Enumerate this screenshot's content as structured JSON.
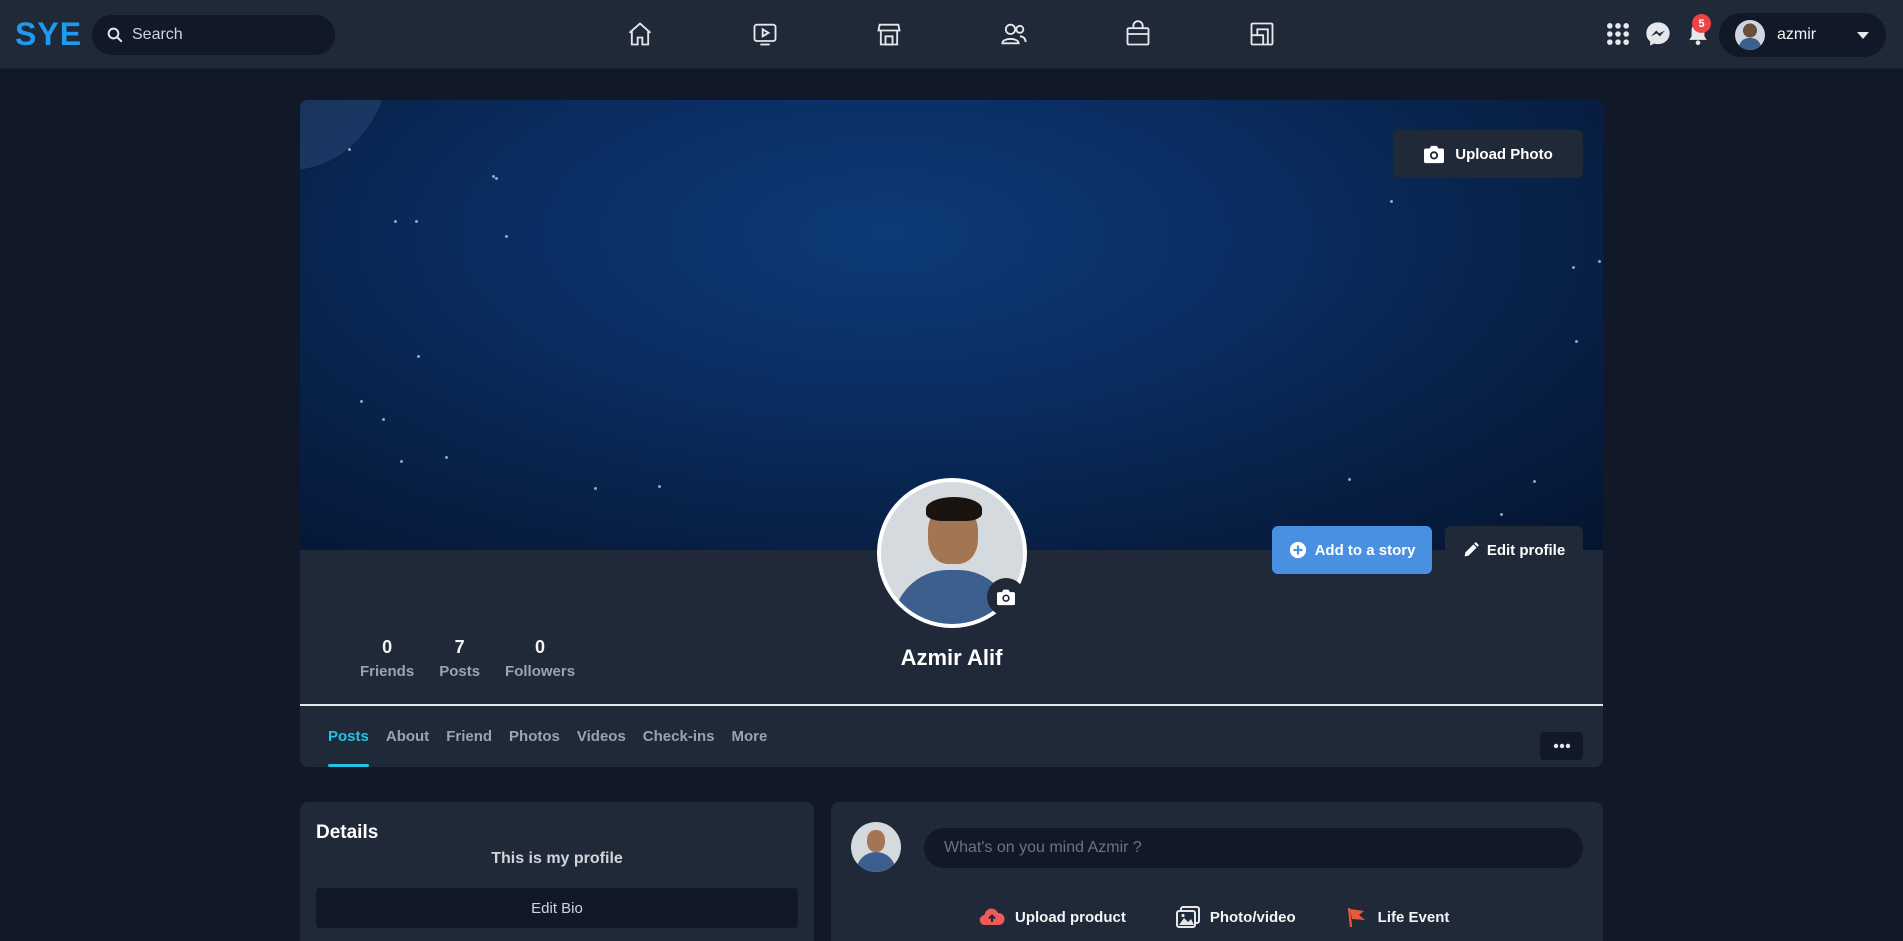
{
  "app": {
    "logo": "SYE",
    "accent_color": "#1d9bf0"
  },
  "search": {
    "placeholder": "Search",
    "value": ""
  },
  "nav": {
    "items": [
      {
        "icon": "home-icon"
      },
      {
        "icon": "video-icon"
      },
      {
        "icon": "marketplace-icon"
      },
      {
        "icon": "groups-icon"
      },
      {
        "icon": "shopping-bag-icon"
      },
      {
        "icon": "pages-icon"
      }
    ]
  },
  "header_right": {
    "menu_icon": "grid-menu-icon",
    "messenger_icon": "messenger-icon",
    "notification_icon": "bell-icon",
    "notification_count": "5",
    "username": "azmir"
  },
  "cover": {
    "upload_label": "Upload Photo"
  },
  "profile": {
    "name": "Azmir Alif",
    "add_story_label": "Add to a story",
    "edit_profile_label": "Edit profile",
    "stats": [
      {
        "value": "0",
        "label": "Friends"
      },
      {
        "value": "7",
        "label": "Posts"
      },
      {
        "value": "0",
        "label": "Followers"
      }
    ]
  },
  "tabs": [
    {
      "label": "Posts",
      "active": true
    },
    {
      "label": "About"
    },
    {
      "label": "Friend"
    },
    {
      "label": "Photos"
    },
    {
      "label": "Videos"
    },
    {
      "label": "Check-ins"
    },
    {
      "label": "More"
    }
  ],
  "details": {
    "title": "Details",
    "bio": "This is my profile",
    "edit_bio_label": "Edit Bio"
  },
  "composer": {
    "placeholder": "What's on you mind Azmir ?",
    "actions": [
      {
        "label": "Upload product",
        "icon": "cloud-upload-icon",
        "color": "#f05a5a"
      },
      {
        "label": "Photo/video",
        "icon": "photo-icon",
        "color": "#e5e7eb"
      },
      {
        "label": "Life Event",
        "icon": "flag-icon",
        "color": "#e8593c"
      }
    ]
  }
}
